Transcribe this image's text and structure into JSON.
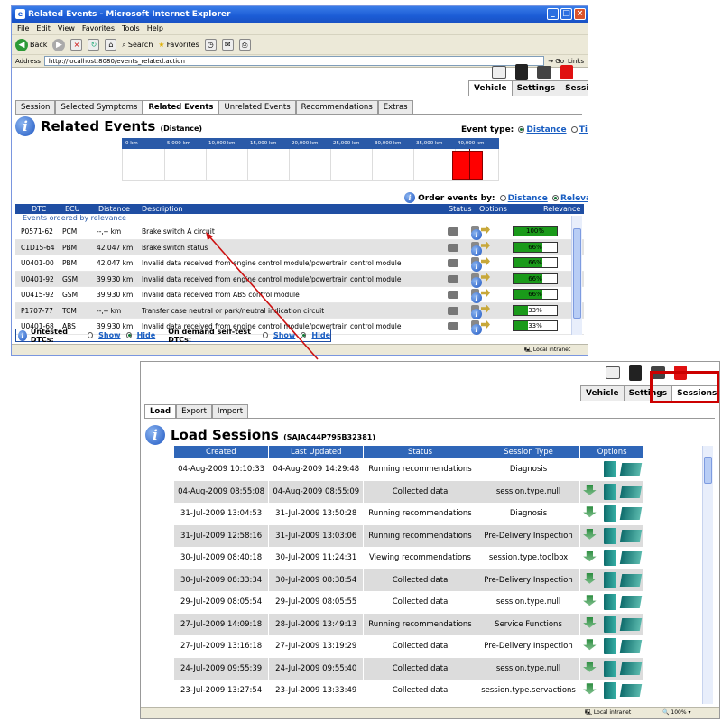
{
  "colors": {
    "accent": "#1f4ea3",
    "highlight": "#cc0000",
    "relevance_bar": "#1a9a1a",
    "timeline_marker": "#ff0000"
  },
  "browser": {
    "title": "Related Events - Microsoft Internet Explorer",
    "menu": [
      "File",
      "Edit",
      "View",
      "Favorites",
      "Tools",
      "Help"
    ],
    "toolbar": {
      "back": "Back",
      "search": "Search",
      "favorites": "Favorites"
    },
    "address_label": "Address",
    "address": "http://localhost:8080/events_related.action",
    "go": "Go",
    "links": "Links",
    "status_zone": "Local intranet"
  },
  "topnav": [
    "Vehicle",
    "Settings",
    "Sessions"
  ],
  "events_tabs": [
    "Session",
    "Selected Symptoms",
    "Related Events",
    "Unrelated Events",
    "Recommendations",
    "Extras"
  ],
  "events_page": {
    "title": "Related Events",
    "subtitle": "(Distance)",
    "event_type_label": "Event type:",
    "event_type_options": [
      "Distance",
      "Time"
    ],
    "timeline_ticks": [
      "0 km",
      "5,000 km",
      "10,000 km",
      "15,000 km",
      "20,000 km",
      "25,000 km",
      "30,000 km",
      "35,000 km",
      "40,000 km"
    ],
    "order_label": "Order events by:",
    "order_options": [
      "Distance",
      "Relevance"
    ],
    "columns": [
      "DTC",
      "ECU",
      "Distance",
      "Description",
      "Status",
      "Options",
      "Relevance"
    ],
    "group_label": "Events ordered by relevance",
    "rows": [
      {
        "dtc": "P0571-62",
        "ecu": "PCM",
        "distance": "--,-- km",
        "desc": "Brake switch A circuit",
        "relevance": 1.0,
        "rel_text": "100%"
      },
      {
        "dtc": "C1D15-64",
        "ecu": "PBM",
        "distance": "42,047 km",
        "desc": "Brake switch status",
        "relevance": 0.66,
        "rel_text": "66%"
      },
      {
        "dtc": "U0401-00",
        "ecu": "PBM",
        "distance": "42,047 km",
        "desc": "Invalid data received from engine control module/powertrain control module",
        "relevance": 0.66,
        "rel_text": "66%"
      },
      {
        "dtc": "U0401-92",
        "ecu": "GSM",
        "distance": "39,930 km",
        "desc": "Invalid data received from engine control module/powertrain control module",
        "relevance": 0.66,
        "rel_text": "66%"
      },
      {
        "dtc": "U0415-92",
        "ecu": "GSM",
        "distance": "39,930 km",
        "desc": "Invalid data received from ABS control module",
        "relevance": 0.66,
        "rel_text": "66%"
      },
      {
        "dtc": "P1707-77",
        "ecu": "TCM",
        "distance": "--,-- km",
        "desc": "Transfer case neutral or park/neutral indication circuit",
        "relevance": 0.33,
        "rel_text": "33%"
      },
      {
        "dtc": "U0401-68",
        "ecu": "ABS",
        "distance": "39,930 km",
        "desc": "Invalid data received from engine control module/powertrain control module",
        "relevance": 0.33,
        "rel_text": "33%"
      }
    ],
    "untested_label": "Untested DTCs:",
    "ondemand_label": "On demand self-test DTCs:",
    "show": "Show",
    "hide": "Hide"
  },
  "sessions_tabs": [
    "Load",
    "Export",
    "Import"
  ],
  "sessions_page": {
    "title": "Load Sessions",
    "vin": "(SAJAC44P795B32381)",
    "columns": [
      "Created",
      "Last Updated",
      "Status",
      "Session Type",
      "Options"
    ],
    "rows": [
      {
        "created": "04-Aug-2009 10:10:33",
        "updated": "04-Aug-2009 14:29:48",
        "status": "Running recommendations",
        "type": "Diagnosis"
      },
      {
        "created": "04-Aug-2009 08:55:08",
        "updated": "04-Aug-2009 08:55:09",
        "status": "Collected data",
        "type": "session.type.null"
      },
      {
        "created": "31-Jul-2009 13:04:53",
        "updated": "31-Jul-2009 13:50:28",
        "status": "Running recommendations",
        "type": "Diagnosis"
      },
      {
        "created": "31-Jul-2009 12:58:16",
        "updated": "31-Jul-2009 13:03:06",
        "status": "Running recommendations",
        "type": "Pre-Delivery Inspection"
      },
      {
        "created": "30-Jul-2009 08:40:18",
        "updated": "30-Jul-2009 11:24:31",
        "status": "Viewing recommendations",
        "type": "session.type.toolbox"
      },
      {
        "created": "30-Jul-2009 08:33:34",
        "updated": "30-Jul-2009 08:38:54",
        "status": "Collected data",
        "type": "Pre-Delivery Inspection"
      },
      {
        "created": "29-Jul-2009 08:05:54",
        "updated": "29-Jul-2009 08:05:55",
        "status": "Collected data",
        "type": "session.type.null"
      },
      {
        "created": "27-Jul-2009 14:09:18",
        "updated": "28-Jul-2009 13:49:13",
        "status": "Running recommendations",
        "type": "Service Functions"
      },
      {
        "created": "27-Jul-2009 13:16:18",
        "updated": "27-Jul-2009 13:19:29",
        "status": "Collected data",
        "type": "Pre-Delivery Inspection"
      },
      {
        "created": "24-Jul-2009 09:55:39",
        "updated": "24-Jul-2009 09:55:40",
        "status": "Collected data",
        "type": "session.type.null"
      },
      {
        "created": "23-Jul-2009 13:27:54",
        "updated": "23-Jul-2009 13:33:49",
        "status": "Collected data",
        "type": "session.type.servactions"
      }
    ],
    "status_zone": "Local intranet",
    "zoom": "100%"
  }
}
